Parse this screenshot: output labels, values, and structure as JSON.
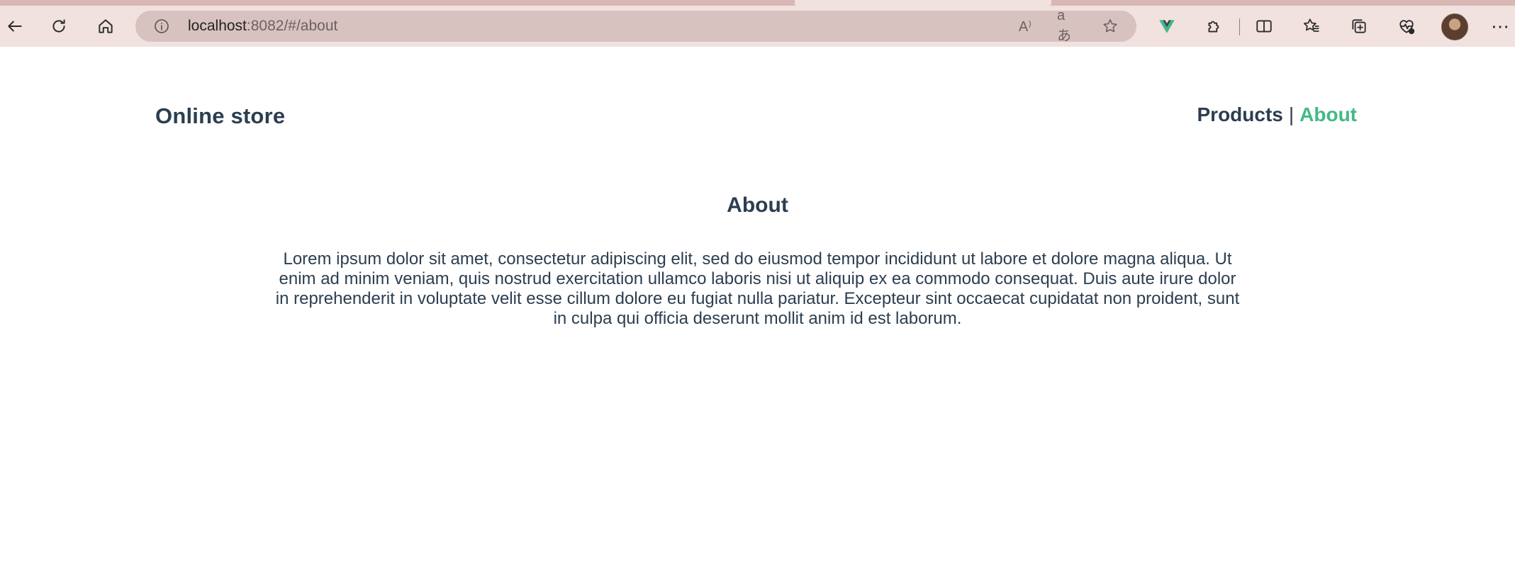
{
  "browser": {
    "address": {
      "host": "localhost",
      "path": ":8082/#/about"
    },
    "icons": {
      "back": "back-arrow-icon",
      "refresh": "refresh-icon",
      "home": "home-icon",
      "info": "info-icon",
      "read_aloud": "read-aloud-icon",
      "translate": "translate-icon",
      "favorite": "star-icon",
      "vue_devtools": "vue-devtools-icon",
      "extensions": "puzzle-icon",
      "split": "split-screen-icon",
      "favorites_list": "favorites-icon",
      "collections": "collections-icon",
      "health": "browser-essentials-icon",
      "profile": "avatar",
      "more": "more-icon"
    },
    "read_aloud_glyph": "A⁾",
    "translate_glyph": "aあ",
    "more_glyph": "⋯"
  },
  "header": {
    "brand": "Online store",
    "nav": [
      {
        "label": "Products",
        "active": false
      },
      {
        "label": "About",
        "active": true
      }
    ],
    "nav_separator": "|"
  },
  "main": {
    "title": "About",
    "body": "Lorem ipsum dolor sit amet, consectetur adipiscing elit, sed do eiusmod tempor incididunt ut labore et dolore magna aliqua. Ut enim ad minim veniam, quis nostrud exercitation ullamco laboris nisi ut aliquip ex ea commodo consequat. Duis aute irure dolor in reprehenderit in voluptate velit esse cillum dolore eu fugiat nulla pariatur. Excepteur sint occaecat cupidatat non proident, sunt in culpa qui officia deserunt mollit anim id est laborum."
  },
  "colors": {
    "accent": "#42b983",
    "text": "#2c3e50",
    "toolbar": "#f1e1df",
    "addressbar": "#d8c2c0"
  }
}
